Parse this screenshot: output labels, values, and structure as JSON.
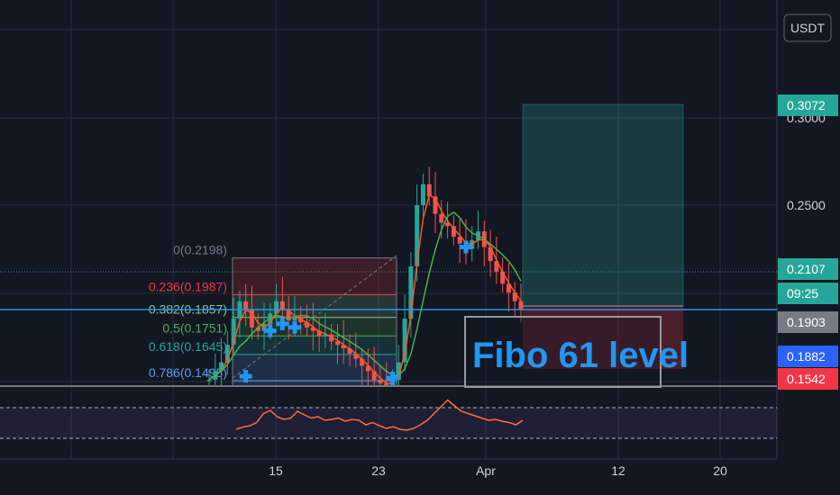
{
  "chart_data": {
    "type": "candlestick",
    "currency": "USDT",
    "x_ticks": [
      "15",
      "23",
      "Apr",
      "12",
      "20"
    ],
    "y_ticks": [
      "0.3000",
      "0.2500"
    ],
    "price_tags": [
      {
        "value": "0.3072",
        "color": "#26a69a"
      },
      {
        "value": "0.2107",
        "color": "#26a69a"
      },
      {
        "value": "09:25",
        "color": "#26a69a"
      },
      {
        "value": "0.1903",
        "color": "#787b86"
      },
      {
        "value": "0.1882",
        "color": "#2962ff"
      },
      {
        "value": "0.1542",
        "color": "#f23645"
      }
    ],
    "fib_levels": [
      {
        "label": "0(0.2198)",
        "level": 0,
        "price": 0.2198,
        "color": "#787b86"
      },
      {
        "label": "0.236(0.1987)",
        "level": 0.236,
        "price": 0.1987,
        "color": "#f23645"
      },
      {
        "label": "0.382(0.1857)",
        "level": 0.382,
        "price": 0.1857,
        "color": "#81c784"
      },
      {
        "label": "0.5(0.1751)",
        "level": 0.5,
        "price": 0.1751,
        "color": "#4caf50"
      },
      {
        "label": "0.618(0.1645)",
        "level": 0.618,
        "price": 0.1645,
        "color": "#26a69a"
      },
      {
        "label": "0.786(0.1495)",
        "level": 0.786,
        "price": 0.1495,
        "color": "#5b9cf6"
      }
    ],
    "annotation": "Fibo 61 level",
    "position_tool": {
      "target": 0.3072,
      "entry": 0.1903,
      "stop": 0.1542
    },
    "close_series": [
      0.15,
      0.155,
      0.16,
      0.17,
      0.185,
      0.195,
      0.19,
      0.18,
      0.178,
      0.182,
      0.188,
      0.195,
      0.19,
      0.184,
      0.186,
      0.183,
      0.18,
      0.178,
      0.175,
      0.176,
      0.172,
      0.17,
      0.168,
      0.165,
      0.162,
      0.158,
      0.155,
      0.15,
      0.148,
      0.146,
      0.15,
      0.16,
      0.185,
      0.215,
      0.25,
      0.262,
      0.255,
      0.245,
      0.24,
      0.238,
      0.232,
      0.228,
      0.225,
      0.23,
      0.235,
      0.226,
      0.218,
      0.212,
      0.205,
      0.2,
      0.195,
      0.19
    ],
    "oscillator": [
      0.2,
      0.25,
      0.28,
      0.35,
      0.55,
      0.62,
      0.48,
      0.42,
      0.45,
      0.6,
      0.52,
      0.45,
      0.48,
      0.4,
      0.42,
      0.45,
      0.38,
      0.42,
      0.4,
      0.3,
      0.35,
      0.28,
      0.22,
      0.26,
      0.2,
      0.18,
      0.22,
      0.3,
      0.4,
      0.55,
      0.7,
      0.85,
      0.72,
      0.6,
      0.55,
      0.5,
      0.45,
      0.4,
      0.42,
      0.38,
      0.35,
      0.3,
      0.4
    ],
    "buy_markers": [
      0.152,
      0.178,
      0.182,
      0.18,
      0.15,
      0.226
    ]
  }
}
